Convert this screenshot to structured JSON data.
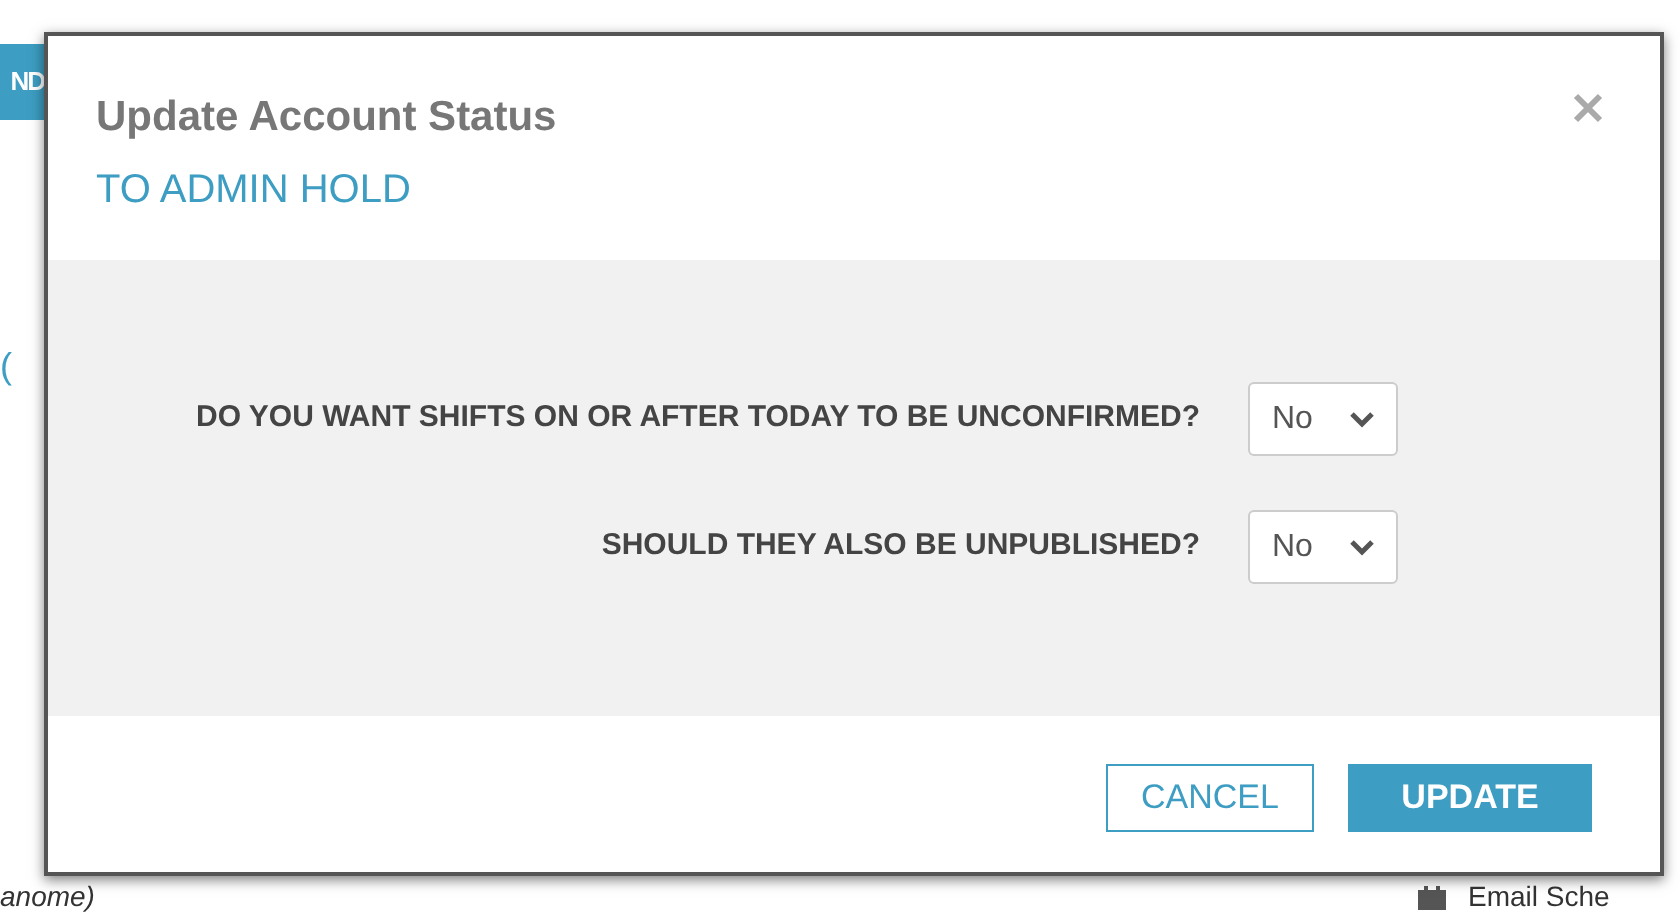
{
  "background": {
    "button": "ND",
    "left_mark": "(",
    "left_note": "anome)",
    "right_link": "Email Sche"
  },
  "dialog": {
    "title": "Update Account Status",
    "subtitle": "TO ADMIN HOLD",
    "questions": [
      {
        "label": "DO YOU WANT SHIFTS ON OR AFTER TODAY TO BE UNCONFIRMED?",
        "value": "No"
      },
      {
        "label": "SHOULD THEY ALSO BE UNPUBLISHED?",
        "value": "No"
      }
    ],
    "buttons": [
      {
        "label": "CANCEL",
        "kind": "secondary"
      },
      {
        "label": "UPDATE",
        "kind": "primary"
      }
    ]
  }
}
